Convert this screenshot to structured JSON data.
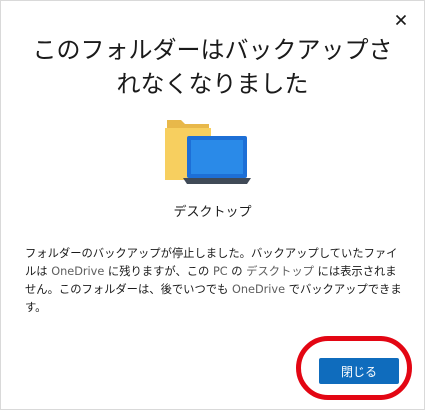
{
  "dialog": {
    "title": "このフォルダーはバックアップされなくなりました",
    "close_icon": "close-icon",
    "folder_name": "デスクトップ",
    "message": {
      "part1": "フォルダーのバックアップが停止しました。バックアップしていたファイルは ",
      "onedrive1": "OneDrive",
      "part2": " に残りますが、この ",
      "pc": "PC",
      "part3": " の ",
      "desktop": "デスクトップ",
      "part4": " には表示されません。このフォルダーは、後でいつでも ",
      "onedrive2": "OneDrive",
      "part5": " でバックアップできます。"
    },
    "close_button_label": "閉じる",
    "accent_color": "#0f6cbd",
    "annotation_color": "#e30613"
  }
}
